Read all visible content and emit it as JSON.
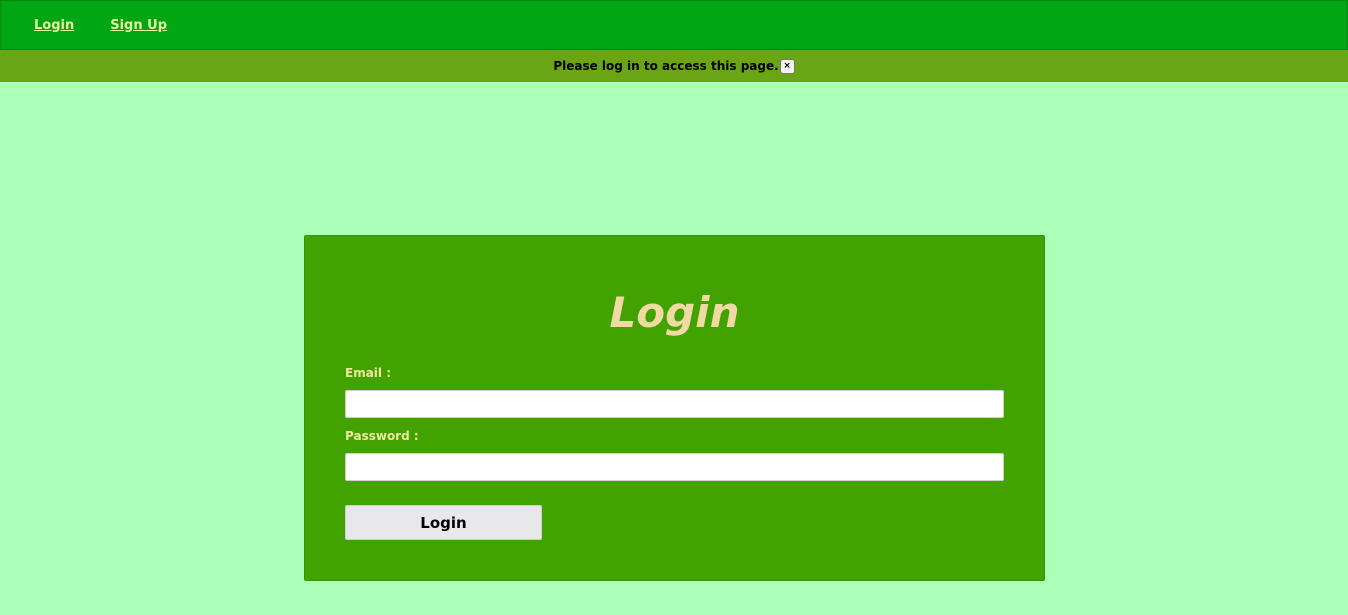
{
  "navbar": {
    "links": [
      {
        "label": "Login"
      },
      {
        "label": "Sign Up"
      }
    ]
  },
  "flash": {
    "message": "Please log in to access this page.",
    "close_label": "×"
  },
  "login_form": {
    "title": "Login",
    "email_label": "Email :",
    "email_value": "",
    "password_label": "Password :",
    "password_value": "",
    "submit_label": "Login"
  },
  "colors": {
    "page_background": "#aaffb9",
    "navbar": "#00a613",
    "flash_bar": "#6aa515",
    "card": "#42a200",
    "title": "#f0d9a3",
    "label": "#f2e7a0"
  }
}
